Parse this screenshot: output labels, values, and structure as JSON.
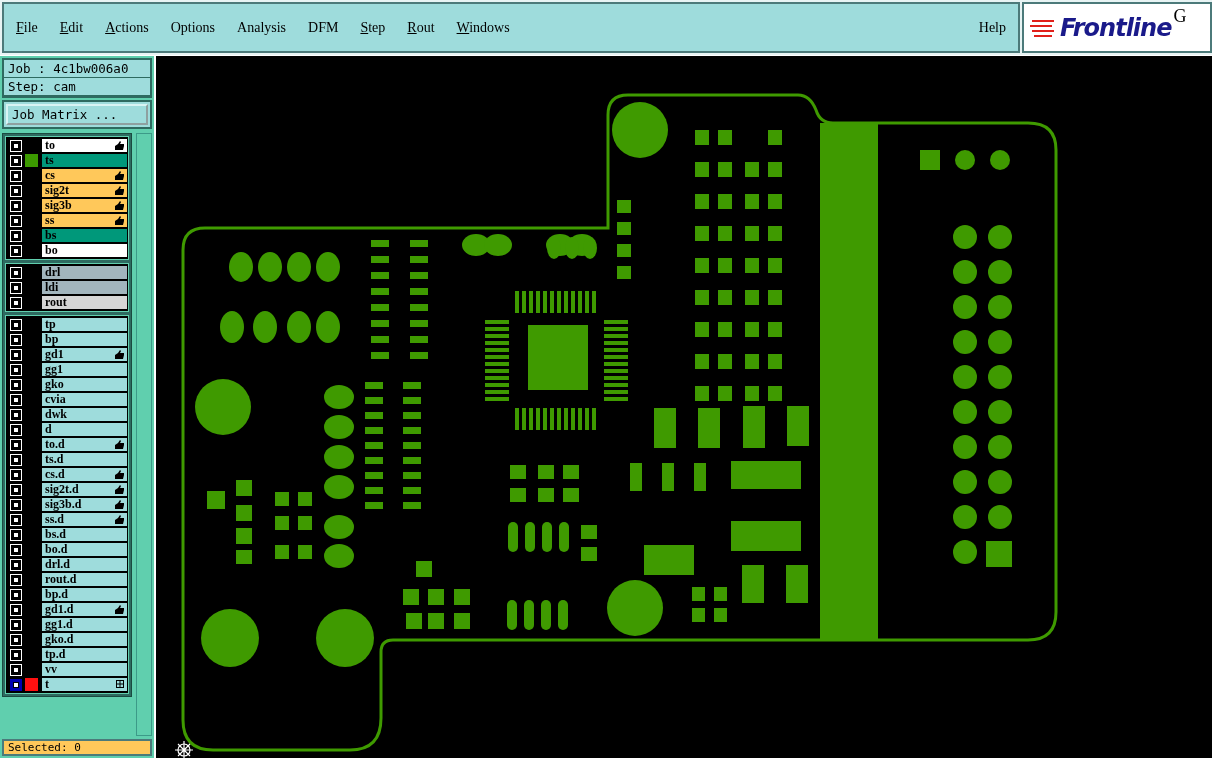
{
  "menu": [
    {
      "label": "File",
      "mnemonic": true
    },
    {
      "label": "Edit",
      "mnemonic": true
    },
    {
      "label": "Actions",
      "mnemonic": true
    },
    {
      "label": "Options",
      "mnemonic": false
    },
    {
      "label": "Analysis",
      "mnemonic": false
    },
    {
      "label": "DFM",
      "mnemonic": false
    },
    {
      "label": "Step",
      "mnemonic": true
    },
    {
      "label": "Rout",
      "mnemonic": true
    },
    {
      "label": "Windows",
      "mnemonic": true
    }
  ],
  "help": "Help",
  "logo": {
    "text": "Frontline",
    "cut_text": "G"
  },
  "job": "Job : 4c1bw006a0",
  "step": "Step: cam",
  "job_matrix_button": "Job Matrix ...",
  "layer_groups": [
    {
      "layers": [
        {
          "name": "to",
          "color": "#ffffff",
          "affected": true,
          "work": false
        },
        {
          "name": "ts",
          "color": "#00987a",
          "swatch": {
            "color": "#3c9a00"
          },
          "affected": false,
          "work": false
        },
        {
          "name": "cs",
          "color": "#ffc85a",
          "affected": true,
          "work": false
        },
        {
          "name": "sig2t",
          "color": "#ffc85a",
          "affected": true,
          "work": false
        },
        {
          "name": "sig3b",
          "color": "#ffc85a",
          "affected": true,
          "work": false
        },
        {
          "name": "ss",
          "color": "#ffc85a",
          "affected": true,
          "work": false
        },
        {
          "name": "bs",
          "color": "#00987a",
          "affected": false,
          "work": false
        },
        {
          "name": "bo",
          "color": "#ffffff",
          "affected": false,
          "work": false
        }
      ]
    },
    {
      "layers": [
        {
          "name": "drl",
          "color": "#a2b5bd",
          "affected": false,
          "work": false
        },
        {
          "name": "ldi",
          "color": "#a2b5bd",
          "affected": false,
          "work": false
        },
        {
          "name": "rout",
          "color": "#d6d6d6",
          "affected": false,
          "work": false
        }
      ]
    },
    {
      "layers": [
        {
          "name": "tp",
          "color": "#9edcdc",
          "affected": false,
          "work": false
        },
        {
          "name": "bp",
          "color": "#9edcdc",
          "affected": false,
          "work": false
        },
        {
          "name": "gd1",
          "color": "#9edcdc",
          "affected": true,
          "work": false
        },
        {
          "name": "gg1",
          "color": "#9edcdc",
          "affected": false,
          "work": false
        },
        {
          "name": "gko",
          "color": "#9edcdc",
          "affected": false,
          "work": false
        },
        {
          "name": "cvia",
          "color": "#9edcdc",
          "affected": false,
          "work": false
        },
        {
          "name": "dwk",
          "color": "#9edcdc",
          "affected": false,
          "work": false
        },
        {
          "name": "d",
          "color": "#9edcdc",
          "affected": false,
          "work": false
        },
        {
          "name": "to.d",
          "color": "#9edcdc",
          "affected": true,
          "work": false
        },
        {
          "name": "ts.d",
          "color": "#9edcdc",
          "affected": false,
          "work": false
        },
        {
          "name": "cs.d",
          "color": "#9edcdc",
          "affected": true,
          "work": false
        },
        {
          "name": "sig2t.d",
          "color": "#9edcdc",
          "affected": true,
          "work": false
        },
        {
          "name": "sig3b.d",
          "color": "#9edcdc",
          "affected": true,
          "work": false
        },
        {
          "name": "ss.d",
          "color": "#9edcdc",
          "affected": true,
          "work": false
        },
        {
          "name": "bs.d",
          "color": "#9edcdc",
          "affected": false,
          "work": false
        },
        {
          "name": "bo.d",
          "color": "#9edcdc",
          "affected": false,
          "work": false
        },
        {
          "name": "drl.d",
          "color": "#9edcdc",
          "affected": false,
          "work": false
        },
        {
          "name": "rout.d",
          "color": "#9edcdc",
          "affected": false,
          "work": false
        },
        {
          "name": "bp.d",
          "color": "#9edcdc",
          "affected": false,
          "work": false
        },
        {
          "name": "gd1.d",
          "color": "#9edcdc",
          "affected": true,
          "work": false
        },
        {
          "name": "gg1.d",
          "color": "#9edcdc",
          "affected": false,
          "work": false
        },
        {
          "name": "gko.d",
          "color": "#9edcdc",
          "affected": false,
          "work": false
        },
        {
          "name": "tp.d",
          "color": "#9edcdc",
          "affected": false,
          "work": false
        },
        {
          "name": "vv",
          "color": "#9edcdc",
          "affected": false,
          "work": false
        },
        {
          "name": "t",
          "color": "#9edcdc",
          "swatch": {
            "color": "#ff1010"
          },
          "affected": false,
          "work": true
        }
      ]
    }
  ],
  "status": "Selected: 0"
}
